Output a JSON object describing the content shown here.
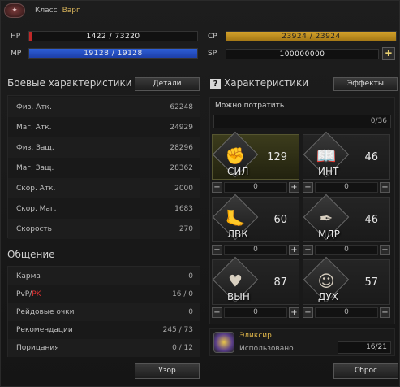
{
  "header": {
    "class_label": "Класс",
    "class_value": "Варг"
  },
  "bars": {
    "hp": {
      "label": "HP",
      "value": "1422 / 73220",
      "fraction": 0.019
    },
    "mp": {
      "label": "MP",
      "value": "19128 / 19128",
      "fraction": 1.0
    },
    "cp": {
      "label": "CP",
      "value": "23924 / 23924",
      "fraction": 1.0
    },
    "sp": {
      "label": "SP",
      "value": "100000000"
    }
  },
  "combat": {
    "title": "Боевые характеристики",
    "details_button": "Детали",
    "rows": [
      {
        "k": "Физ. Атк.",
        "v": "62248"
      },
      {
        "k": "Маг. Атк.",
        "v": "24929"
      },
      {
        "k": "Физ. Защ.",
        "v": "28296"
      },
      {
        "k": "Маг. Защ.",
        "v": "28362"
      },
      {
        "k": "Скор. Атк.",
        "v": "2000"
      },
      {
        "k": "Скор. Маг.",
        "v": "1683"
      },
      {
        "k": "Скорость",
        "v": "270"
      }
    ]
  },
  "social": {
    "title": "Общение",
    "rows": [
      {
        "k": "Карма",
        "v": "0"
      },
      {
        "k_a": "PvP/",
        "k_b": "PK",
        "v": "16 / 0"
      },
      {
        "k": "Рейдовые очки",
        "v": "0"
      },
      {
        "k": "Рекомендации",
        "v": "245 / 73"
      },
      {
        "k": "Порицания",
        "v": "0 / 12"
      }
    ]
  },
  "stats": {
    "help_icon": "?",
    "title": "Характеристики",
    "effects_button": "Эффекты",
    "can_spend_label": "Можно потратить",
    "can_spend_value": "0/36",
    "items": [
      {
        "name": "СИЛ",
        "value": "129",
        "input": "0",
        "icon": "arm-icon"
      },
      {
        "name": "ИНТ",
        "value": "46",
        "input": "0",
        "icon": "book-icon"
      },
      {
        "name": "ЛВК",
        "value": "60",
        "input": "0",
        "icon": "foot-icon"
      },
      {
        "name": "МДР",
        "value": "46",
        "input": "0",
        "icon": "feather-icon"
      },
      {
        "name": "ВЫН",
        "value": "87",
        "input": "0",
        "icon": "heart-icon"
      },
      {
        "name": "ДУХ",
        "value": "57",
        "input": "0",
        "icon": "head-icon"
      }
    ],
    "minus": "−",
    "plus": "+"
  },
  "elixir": {
    "title": "Эликсир",
    "used_label": "Использовано",
    "count": "16/21"
  },
  "footer": {
    "pattern_button": "Узор",
    "reset_button": "Сброс"
  }
}
